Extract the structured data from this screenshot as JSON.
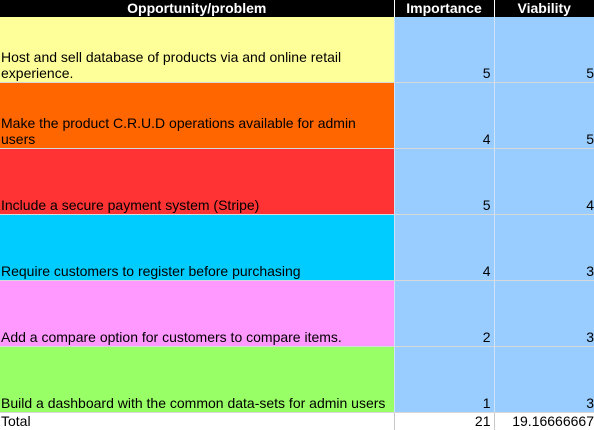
{
  "sheet": {
    "headers": {
      "opportunity": "Opportunity/problem",
      "importance": "Importance",
      "viability": "Viability"
    },
    "rows": [
      {
        "text": "Host and sell database of products via and online retail experience.",
        "importance": "5",
        "viability": "5",
        "color": "#ffff99"
      },
      {
        "text": "Make the product C.R.U.D operations available for admin users",
        "importance": "4",
        "viability": "5",
        "color": "#ff6600"
      },
      {
        "text": "Include a secure payment system (Stripe)",
        "importance": "5",
        "viability": "4",
        "color": "#ff3333"
      },
      {
        "text": "Require customers to register before purchasing",
        "importance": "4",
        "viability": "3",
        "color": "#00ccff"
      },
      {
        "text": "Add a compare option for customers to compare items.",
        "importance": "2",
        "viability": "3",
        "color": "#ff99ff"
      },
      {
        "text": "Build a dashboard with the common data-sets for admin users",
        "importance": "1",
        "viability": "3",
        "color": "#99ff66"
      }
    ],
    "total": {
      "label": "Total",
      "importance": "21",
      "viability": "19.16666667"
    },
    "colors": {
      "header_bg": "#000000",
      "header_text": "#ffffff",
      "number_bg": "#99ccff"
    }
  }
}
